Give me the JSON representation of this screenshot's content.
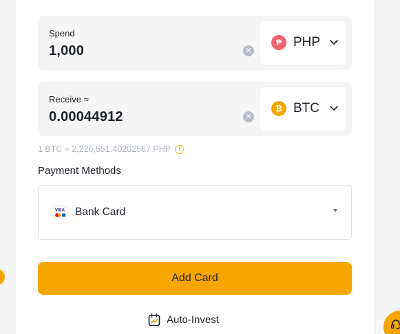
{
  "spend": {
    "label": "Spend",
    "value": "1,000",
    "currency": "PHP",
    "currency_icon": "peso-coin-icon",
    "currency_symbol": "₱"
  },
  "receive": {
    "label": "Receive ≈",
    "value": "0.00044912",
    "currency": "BTC",
    "currency_icon": "bitcoin-coin-icon",
    "currency_symbol": "₿"
  },
  "rate": {
    "text": "1 BTC ≈ 2,226,551.40202567 PHP",
    "icon": "info-icon"
  },
  "payment": {
    "title": "Payment Methods",
    "selected": "Bank Card",
    "icon": "visa-mastercard-icon"
  },
  "actions": {
    "add_card": "Add Card",
    "auto_invest": "Auto-Invest"
  },
  "colors": {
    "accent": "#f7a600",
    "field_bg": "#f5f5f5",
    "php_coin": "#f0616d",
    "btc_coin": "#f7a600",
    "muted_text": "#aeb4bc"
  }
}
